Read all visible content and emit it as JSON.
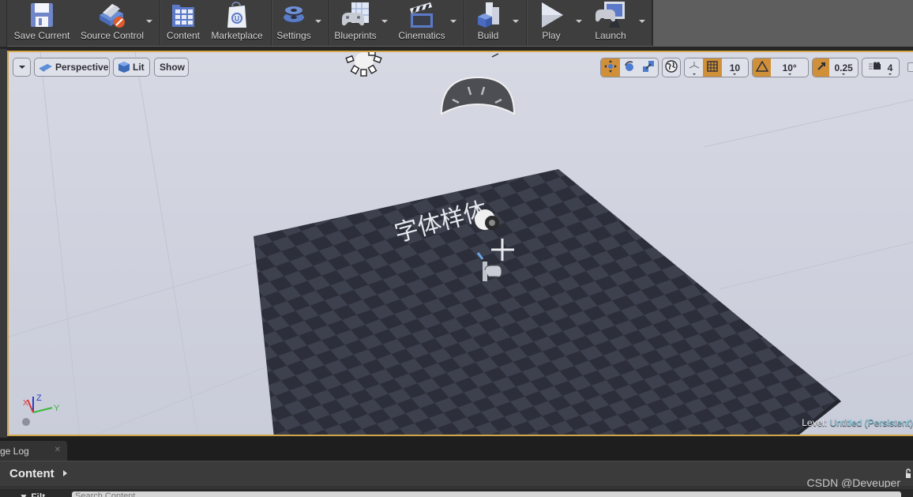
{
  "toolbar": {
    "buttons": [
      {
        "id": "save-current",
        "label": "Save Current",
        "icon": "floppy-disk-icon",
        "has_menu": false
      },
      {
        "id": "source-control",
        "label": "Source Control",
        "icon": "source-control-icon",
        "has_menu": true
      },
      {
        "id": "content",
        "label": "Content",
        "icon": "content-browser-icon",
        "has_menu": false
      },
      {
        "id": "marketplace",
        "label": "Marketplace",
        "icon": "marketplace-bag-icon",
        "has_menu": false
      },
      {
        "id": "settings",
        "label": "Settings",
        "icon": "gear-icon",
        "has_menu": true
      },
      {
        "id": "blueprints",
        "label": "Blueprints",
        "icon": "blueprint-gamepad-icon",
        "has_menu": true
      },
      {
        "id": "cinematics",
        "label": "Cinematics",
        "icon": "clapperboard-icon",
        "has_menu": true
      },
      {
        "id": "build",
        "label": "Build",
        "icon": "build-blocks-icon",
        "has_menu": true
      },
      {
        "id": "play",
        "label": "Play",
        "icon": "play-icon",
        "has_menu": true
      },
      {
        "id": "launch",
        "label": "Launch",
        "icon": "launch-monitor-icon",
        "has_menu": true
      }
    ]
  },
  "viewport": {
    "options_menu": "viewport-options-caret",
    "view_mode": "Perspective",
    "lighting_mode": "Lit",
    "show_label": "Show",
    "transform_tools": {
      "translate": true,
      "rotate": false,
      "scale": false,
      "active": "translate"
    },
    "coordinate_space": "world",
    "grid_snap": {
      "enabled": true,
      "value": "10"
    },
    "rotation_snap": {
      "enabled": true,
      "value": "10°"
    },
    "scale_snap": {
      "enabled": true,
      "value": "0.25"
    },
    "camera_speed": "4",
    "scene_text": "字体样体",
    "axes": {
      "z": "Z",
      "y": "Y",
      "x": "X"
    },
    "level_label": "Level:",
    "level_value": "Untitled (Persistent)",
    "colors": {
      "accent": "#d0903a",
      "viewport_border": "#d2a54a",
      "level_value": "#8fd3e8",
      "sky": "#d0d3e0",
      "floor_dark": "#2c2f3a",
      "floor_light": "#3d414d"
    }
  },
  "bottom": {
    "tab_label": "ge Log",
    "content_title": "Content",
    "filter_label": "Filt",
    "search_placeholder": "Search Content",
    "watermark": "CSDN @Deveuper"
  }
}
